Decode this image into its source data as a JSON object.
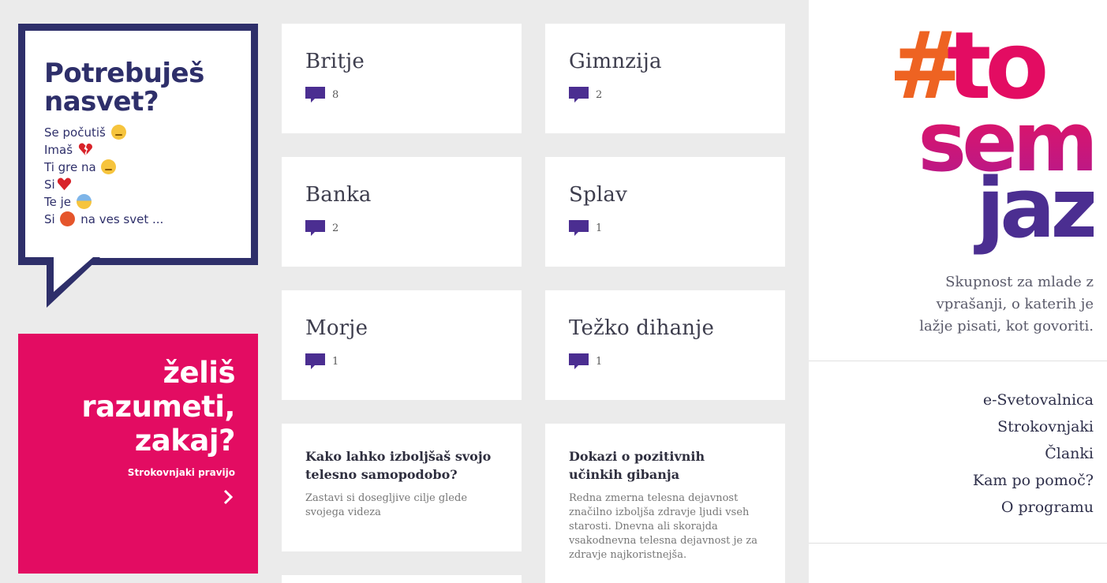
{
  "sidebar_left": {
    "bubble": {
      "heading_line1": "Potrebuješ",
      "heading_line2": "nasvet?",
      "moods": [
        {
          "before": "Se počutiš",
          "emoji": "disappointed-face-icon",
          "after": ""
        },
        {
          "before": "Imaš",
          "emoji": "broken-heart-icon",
          "after": ""
        },
        {
          "before": "Ti gre na",
          "emoji": "crying-face-icon",
          "after": ""
        },
        {
          "before": "Si",
          "emoji": "red-heart-icon",
          "after": ""
        },
        {
          "before": "Te je",
          "emoji": "fearful-face-icon",
          "after": ""
        },
        {
          "before": "Si",
          "emoji": "angry-face-icon",
          "after": "na ves svet ..."
        }
      ]
    },
    "promo": {
      "line1": "želiš",
      "line2": "razumeti,",
      "line3": "zakaj?",
      "subtitle": "Strokovnjaki pravijo",
      "arrow_icon": "chevron-right-icon"
    }
  },
  "topics": [
    {
      "title": "Britje",
      "count": "8"
    },
    {
      "title": "Gimnzija",
      "count": "2"
    },
    {
      "title": "Banka",
      "count": "2"
    },
    {
      "title": "Splav",
      "count": "1"
    },
    {
      "title": "Morje",
      "count": "1"
    },
    {
      "title": "Težko dihanje",
      "count": "1"
    }
  ],
  "articles": [
    {
      "title": "Kako lahko izboljšaš svojo telesno samopodobo?",
      "excerpt": "Zastavi si dosegljive cilje glede svojega videza"
    },
    {
      "title": "Dokazi o pozitivnih učinkih gibanja",
      "excerpt": "Redna zmerna telesna dejavnost značilno izboljša zdravje ljudi vseh starosti. Dnevna ali skorajda vsakodnevna telesna dejavnost je za zdravje najkoristnejša."
    }
  ],
  "brand": {
    "logo_line1_hash": "#",
    "logo_line1": "to",
    "logo_line2": "sem",
    "logo_line3": "jaz",
    "tagline": "Skupnost za mlade z vprašanji, o katerih je lažje pisati, kot govoriti."
  },
  "nav": [
    "e-Svetovalnica",
    "Strokovnjaki",
    "Članki",
    "Kam po pomoč?",
    "O programu"
  ],
  "colors": {
    "navy": "#2e2f6a",
    "pink": "#e30c62",
    "purple": "#4b2e91",
    "orange": "#ee6322",
    "background": "#ebebeb"
  }
}
